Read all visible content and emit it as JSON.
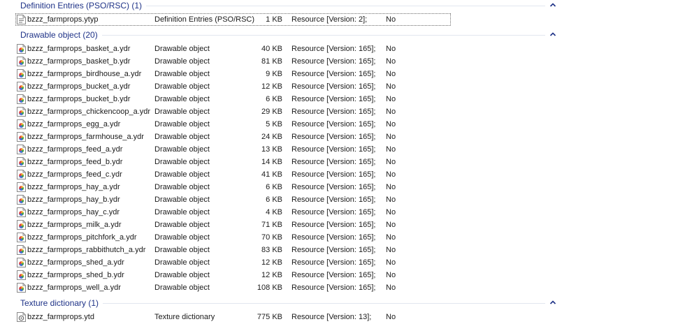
{
  "groups": [
    {
      "title": "Definition Entries (PSO/RSC) (1)",
      "icon": "ytyp-file-icon",
      "rows": [
        {
          "name": "bzzz_farmprops.ytyp",
          "type": "Definition Entries (PSO/RSC)",
          "size": "1 KB",
          "resource": "Resource [Version: 2];",
          "flag": "No"
        }
      ]
    },
    {
      "title": "Drawable object (20)",
      "icon": "ydr-file-icon",
      "rows": [
        {
          "name": "bzzz_farmprops_basket_a.ydr",
          "type": "Drawable object",
          "size": "40 KB",
          "resource": "Resource [Version: 165];",
          "flag": "No"
        },
        {
          "name": "bzzz_farmprops_basket_b.ydr",
          "type": "Drawable object",
          "size": "81 KB",
          "resource": "Resource [Version: 165];",
          "flag": "No"
        },
        {
          "name": "bzzz_farmprops_birdhouse_a.ydr",
          "type": "Drawable object",
          "size": "9 KB",
          "resource": "Resource [Version: 165];",
          "flag": "No"
        },
        {
          "name": "bzzz_farmprops_bucket_a.ydr",
          "type": "Drawable object",
          "size": "12 KB",
          "resource": "Resource [Version: 165];",
          "flag": "No"
        },
        {
          "name": "bzzz_farmprops_bucket_b.ydr",
          "type": "Drawable object",
          "size": "6 KB",
          "resource": "Resource [Version: 165];",
          "flag": "No"
        },
        {
          "name": "bzzz_farmprops_chickencoop_a.ydr",
          "type": "Drawable object",
          "size": "29 KB",
          "resource": "Resource [Version: 165];",
          "flag": "No"
        },
        {
          "name": "bzzz_farmprops_egg_a.ydr",
          "type": "Drawable object",
          "size": "5 KB",
          "resource": "Resource [Version: 165];",
          "flag": "No"
        },
        {
          "name": "bzzz_farmprops_farmhouse_a.ydr",
          "type": "Drawable object",
          "size": "24 KB",
          "resource": "Resource [Version: 165];",
          "flag": "No"
        },
        {
          "name": "bzzz_farmprops_feed_a.ydr",
          "type": "Drawable object",
          "size": "13 KB",
          "resource": "Resource [Version: 165];",
          "flag": "No"
        },
        {
          "name": "bzzz_farmprops_feed_b.ydr",
          "type": "Drawable object",
          "size": "14 KB",
          "resource": "Resource [Version: 165];",
          "flag": "No"
        },
        {
          "name": "bzzz_farmprops_feed_c.ydr",
          "type": "Drawable object",
          "size": "41 KB",
          "resource": "Resource [Version: 165];",
          "flag": "No"
        },
        {
          "name": "bzzz_farmprops_hay_a.ydr",
          "type": "Drawable object",
          "size": "6 KB",
          "resource": "Resource [Version: 165];",
          "flag": "No"
        },
        {
          "name": "bzzz_farmprops_hay_b.ydr",
          "type": "Drawable object",
          "size": "6 KB",
          "resource": "Resource [Version: 165];",
          "flag": "No"
        },
        {
          "name": "bzzz_farmprops_hay_c.ydr",
          "type": "Drawable object",
          "size": "4 KB",
          "resource": "Resource [Version: 165];",
          "flag": "No"
        },
        {
          "name": "bzzz_farmprops_milk_a.ydr",
          "type": "Drawable object",
          "size": "71 KB",
          "resource": "Resource [Version: 165];",
          "flag": "No"
        },
        {
          "name": "bzzz_farmprops_pitchfork_a.ydr",
          "type": "Drawable object",
          "size": "70 KB",
          "resource": "Resource [Version: 165];",
          "flag": "No"
        },
        {
          "name": "bzzz_farmprops_rabbithutch_a.ydr",
          "type": "Drawable object",
          "size": "83 KB",
          "resource": "Resource [Version: 165];",
          "flag": "No"
        },
        {
          "name": "bzzz_farmprops_shed_a.ydr",
          "type": "Drawable object",
          "size": "12 KB",
          "resource": "Resource [Version: 165];",
          "flag": "No"
        },
        {
          "name": "bzzz_farmprops_shed_b.ydr",
          "type": "Drawable object",
          "size": "12 KB",
          "resource": "Resource [Version: 165];",
          "flag": "No"
        },
        {
          "name": "bzzz_farmprops_well_a.ydr",
          "type": "Drawable object",
          "size": "108 KB",
          "resource": "Resource [Version: 165];",
          "flag": "No"
        }
      ]
    },
    {
      "title": "Texture dictionary (1)",
      "icon": "ytd-file-icon",
      "rows": [
        {
          "name": "bzzz_farmprops.ytd",
          "type": "Texture dictionary",
          "size": "775 KB",
          "resource": "Resource [Version: 13];",
          "flag": "No"
        }
      ]
    }
  ],
  "colors": {
    "group_title": "#1e3287",
    "group_line": "#e2e6ef",
    "chevron": "#1e3287"
  }
}
